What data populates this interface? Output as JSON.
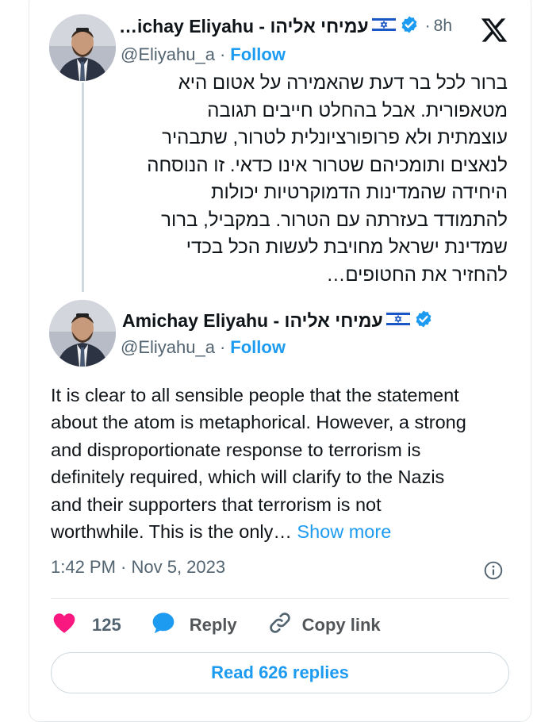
{
  "quoted_tweet": {
    "display_name": "…ichay Eliyahu - עמיחי אליהו",
    "handle": "@Eliyahu_a",
    "separator": "·",
    "follow_label": "Follow",
    "age": "8h",
    "text_lines": [
      "ברור לכל בר דעת שהאמירה על אטום היא",
      "מטאפורית. אבל בהחלט חייבים תגובה",
      "עוצמתית ולא פרופורציונלית לטרור, שתבהיר",
      "לנאצים ותומכיהם שטרור אינו כדאי. זו הנוסחה",
      "היחידה שהמדינות הדמוקרטיות יכולות",
      "להתמודד בעזרתה עם הטרור. במקביל, ברור",
      "שמדינת ישראל מחויבת לעשות הכל בכדי",
      "להחזיר את החטופים…"
    ]
  },
  "main_tweet": {
    "display_name": "Amichay Eliyahu - עמיחי אליהו",
    "handle": "@Eliyahu_a",
    "separator": "·",
    "follow_label": "Follow",
    "text_lines": [
      "It is clear to all sensible people that the statement",
      "about the atom is metaphorical. However, a strong",
      "and disproportionate response to terrorism is",
      "definitely required, which will clarify to the Nazis",
      "and their supporters that terrorism is not"
    ],
    "last_line": "worthwhile. This is the only…",
    "show_more_label": "Show more",
    "timestamp": "1:42 PM · Nov 5, 2023",
    "likes": "125",
    "reply_label": "Reply",
    "copy_link_label": "Copy link",
    "read_replies_label": "Read 626 replies"
  },
  "icons": {
    "flag": "israel-flag-icon",
    "verified": "verified-badge-icon",
    "platform": "x-logo-icon",
    "info": "info-icon",
    "like": "heart-icon",
    "reply": "speech-bubble-icon",
    "link": "link-icon"
  },
  "colors": {
    "accent": "#1d9bf0",
    "like": "#f91880",
    "text": "#0f1419",
    "secondary": "#536471",
    "border": "#cfd9de"
  }
}
